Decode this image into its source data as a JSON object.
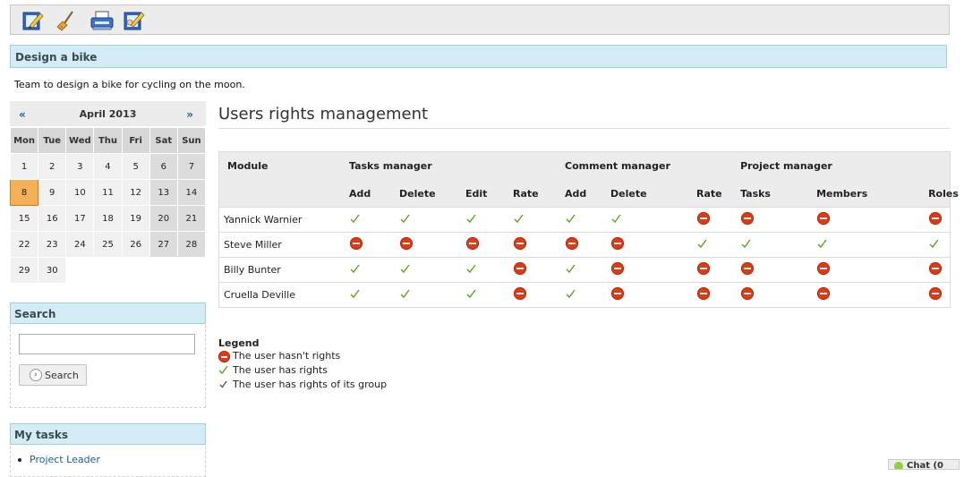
{
  "toolbar": {
    "icons": [
      "edit-pencil-icon",
      "broom-icon",
      "printer-icon",
      "user-edit-icon"
    ]
  },
  "project": {
    "title": "Design a bike",
    "description": "Team to design a bike for cycling on the moon."
  },
  "calendar": {
    "prev": "«",
    "next": "»",
    "month": "April 2013",
    "weekdays": [
      "Mon",
      "Tue",
      "Wed",
      "Thu",
      "Fri",
      "Sat",
      "Sun"
    ],
    "weeks": [
      [
        "1",
        "2",
        "3",
        "4",
        "5",
        "6",
        "7"
      ],
      [
        "8",
        "9",
        "10",
        "11",
        "12",
        "13",
        "14"
      ],
      [
        "15",
        "16",
        "17",
        "18",
        "19",
        "20",
        "21"
      ],
      [
        "22",
        "23",
        "24",
        "25",
        "26",
        "27",
        "28"
      ],
      [
        "29",
        "30",
        "",
        "",
        "",
        "",
        ""
      ]
    ],
    "today": "8"
  },
  "search": {
    "title": "Search",
    "input_value": "",
    "button_label": "Search"
  },
  "tasks": {
    "title": "My tasks",
    "items": [
      "Project Leader"
    ]
  },
  "main": {
    "title": "Users rights management",
    "table": {
      "module_label": "Module",
      "groups": [
        {
          "label": "Tasks manager",
          "cols": [
            "Add",
            "Delete",
            "Edit",
            "Rate"
          ]
        },
        {
          "label": "Comment manager",
          "cols": [
            "Add",
            "Delete",
            "Rate"
          ]
        },
        {
          "label": "Project manager",
          "cols": [
            "Tasks",
            "Members",
            "Roles"
          ]
        }
      ],
      "rows": [
        {
          "user": "Yannick Warnier",
          "rights": [
            "yes",
            "yes",
            "yes",
            "yes",
            "yes",
            "yes",
            "no",
            "no",
            "no",
            "no"
          ]
        },
        {
          "user": "Steve Miller",
          "rights": [
            "no",
            "no",
            "no",
            "no",
            "no",
            "no",
            "yes",
            "yes",
            "yes",
            "yes"
          ]
        },
        {
          "user": "Billy Bunter",
          "rights": [
            "yes",
            "yes",
            "yes",
            "no",
            "yes",
            "no",
            "no",
            "no",
            "no",
            "no"
          ]
        },
        {
          "user": "Cruella Deville",
          "rights": [
            "yes",
            "yes",
            "yes",
            "no",
            "yes",
            "no",
            "no",
            "no",
            "no",
            "no"
          ]
        }
      ]
    }
  },
  "legend": {
    "title": "Legend",
    "no_rights": "The user hasn't rights",
    "has_rights": "The user has rights",
    "group_rights": "The user has rights of its group"
  },
  "chat": {
    "label": "Chat (0"
  },
  "colors": {
    "header_bg": "#d3ecf5",
    "toolbar_bg": "#ececec",
    "no_rights": "#e23a17",
    "has_rights": "#5aa51f",
    "link": "#1a5ea8",
    "today": "#f5b15a"
  }
}
